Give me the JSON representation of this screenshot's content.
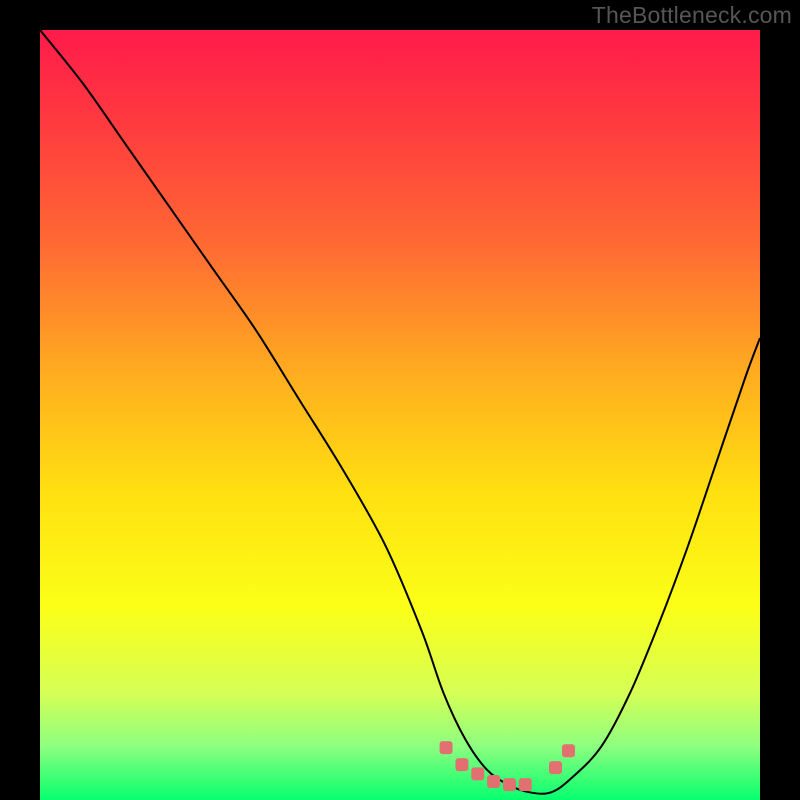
{
  "watermark": "TheBottleneck.com",
  "chart_data": {
    "type": "line",
    "title": "",
    "xlabel": "",
    "ylabel": "",
    "xlim": [
      0,
      100
    ],
    "ylim": [
      0,
      100
    ],
    "gradient_stops": [
      {
        "offset": 0,
        "color": "#ff1b4b"
      },
      {
        "offset": 0.12,
        "color": "#ff3a3f"
      },
      {
        "offset": 0.28,
        "color": "#ff6a33"
      },
      {
        "offset": 0.45,
        "color": "#ffae1f"
      },
      {
        "offset": 0.6,
        "color": "#ffe010"
      },
      {
        "offset": 0.75,
        "color": "#fbff18"
      },
      {
        "offset": 0.86,
        "color": "#d6ff55"
      },
      {
        "offset": 0.93,
        "color": "#8dff80"
      },
      {
        "offset": 1.0,
        "color": "#06ff6e"
      }
    ],
    "series": [
      {
        "name": "bottleneck-curve",
        "stroke": "#000000",
        "stroke_width": 2,
        "x": [
          0,
          6,
          12,
          18,
          24,
          30,
          36,
          42,
          48,
          53,
          56,
          59,
          62,
          65,
          68,
          71,
          74,
          78,
          82,
          86,
          90,
          94,
          98,
          100
        ],
        "y": [
          100,
          93,
          85,
          77,
          69,
          61,
          52,
          43,
          33,
          22,
          14,
          8,
          4,
          2,
          1,
          1,
          3,
          7,
          14,
          23,
          33,
          44,
          55,
          60
        ]
      }
    ],
    "markers": {
      "name": "valley-markers",
      "shape": "rounded-square",
      "fill": "#e27070",
      "size": 13,
      "x": [
        56.4,
        58.6,
        60.8,
        63.0,
        65.2,
        67.4,
        71.6,
        73.4
      ],
      "y": [
        6.8,
        4.6,
        3.4,
        2.4,
        2.0,
        2.0,
        4.2,
        6.4
      ]
    }
  }
}
